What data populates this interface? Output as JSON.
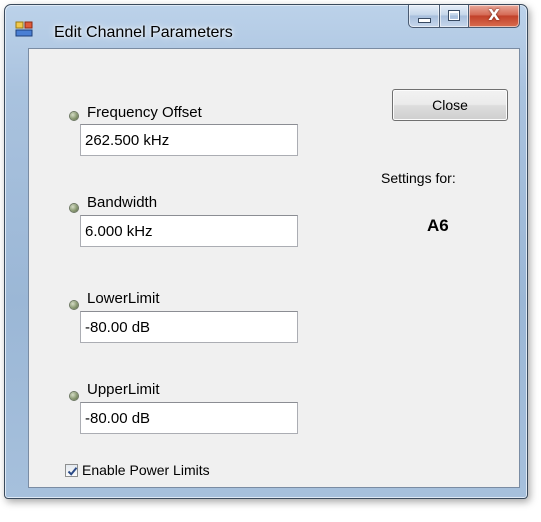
{
  "window": {
    "title": "Edit Channel Parameters",
    "icon": "app-window-icon",
    "controls": {
      "minimize_icon": "minimize-icon",
      "maximize_icon": "maximize-icon",
      "close_glyph": "X"
    }
  },
  "fields": [
    {
      "label": "Frequency Offset",
      "value": "262.500 kHz"
    },
    {
      "label": "Bandwidth",
      "value": "6.000 kHz"
    },
    {
      "label": "LowerLimit",
      "value": "-80.00 dB"
    },
    {
      "label": "UpperLimit",
      "value": "-80.00 dB"
    }
  ],
  "close_button_label": "Close",
  "settings": {
    "label": "Settings for:",
    "value": "A6"
  },
  "enable_power_limits": {
    "label": "Enable Power Limits",
    "checked": true
  },
  "colors": {
    "title_bar": "#a9c2de",
    "client_background": "#f0f0f0",
    "close_caption_button": "#c2412a"
  }
}
